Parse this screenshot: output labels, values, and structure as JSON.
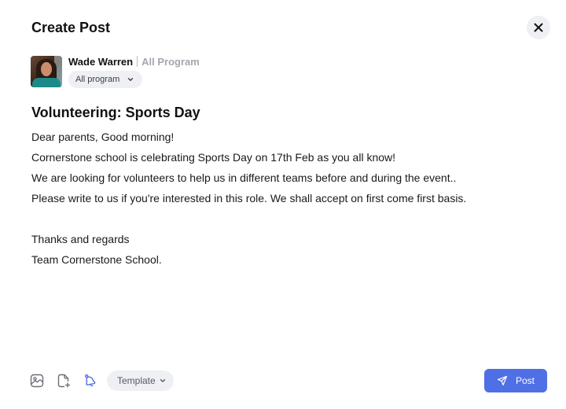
{
  "header": {
    "title": "Create Post",
    "close_icon": "close-icon"
  },
  "author": {
    "name": "Wade Warren",
    "program_label": "All Program",
    "program_select": {
      "selected": "All program",
      "icon": "chevron-down-icon"
    }
  },
  "post": {
    "title": "Volunteering: Sports Day",
    "body_lines": [
      "Dear parents, Good morning!",
      "Cornerstone school is celebrating Sports Day on 17th Feb as you all know!",
      "We are looking for volunteers to help us in different teams before and during the event..",
      "Please write to us if you're interested in this role. We shall accept on first come first basis.",
      "",
      "Thanks and regards",
      "Team Cornerstone School."
    ]
  },
  "toolbar": {
    "tools": [
      {
        "name": "add-image",
        "icon": "image-icon"
      },
      {
        "name": "add-file",
        "icon": "file-plus-icon"
      },
      {
        "name": "notification",
        "icon": "bell-icon",
        "active": true
      }
    ],
    "template_label": "Template",
    "post_label": "Post"
  },
  "colors": {
    "accent": "#4f6fe6",
    "pill_bg": "#eef0f4",
    "muted_text": "#a4a7ae"
  }
}
